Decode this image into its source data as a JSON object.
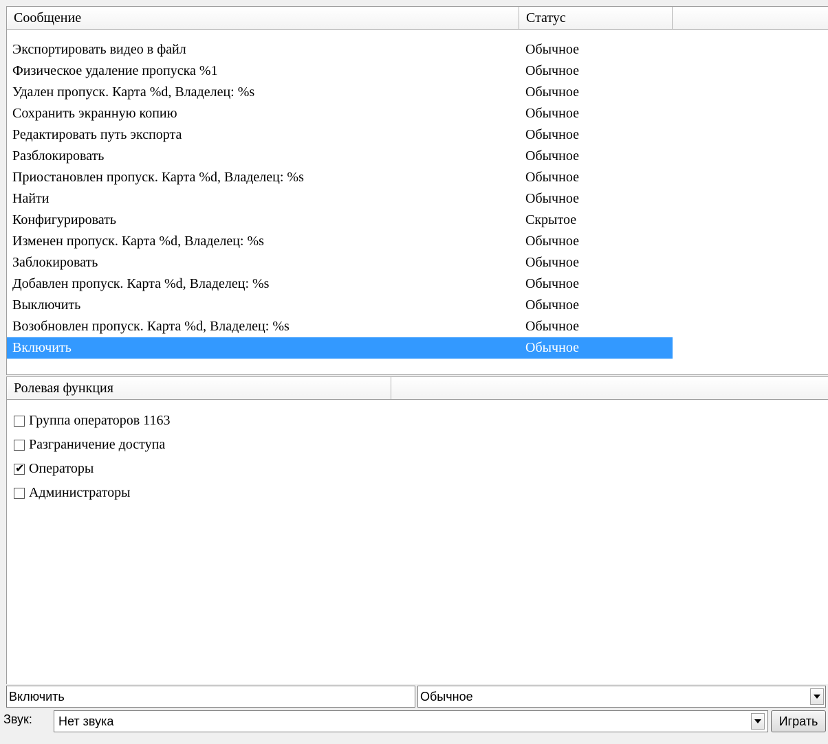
{
  "messages_table": {
    "headers": {
      "message": "Сообщение",
      "status": "Статус"
    },
    "rows": [
      {
        "message": "Экспортировать видео в файл",
        "status": "Обычное"
      },
      {
        "message": "Физическое удаление пропуска %1",
        "status": "Обычное"
      },
      {
        "message": "Удален пропуск. Карта %d, Владелец: %s",
        "status": "Обычное"
      },
      {
        "message": "Сохранить экранную копию",
        "status": "Обычное"
      },
      {
        "message": "Редактировать путь экспорта",
        "status": "Обычное"
      },
      {
        "message": "Разблокировать",
        "status": "Обычное"
      },
      {
        "message": "Приостановлен пропуск. Карта %d, Владелец: %s",
        "status": "Обычное"
      },
      {
        "message": "Найти",
        "status": "Обычное"
      },
      {
        "message": "Конфигурировать",
        "status": "Скрытое"
      },
      {
        "message": "Изменен пропуск. Карта %d, Владелец: %s",
        "status": "Обычное"
      },
      {
        "message": "Заблокировать",
        "status": "Обычное"
      },
      {
        "message": "Добавлен пропуск. Карта %d, Владелец: %s",
        "status": "Обычное"
      },
      {
        "message": "Выключить",
        "status": "Обычное"
      },
      {
        "message": "Возобновлен пропуск. Карта %d, Владелец: %s",
        "status": "Обычное"
      },
      {
        "message": "Включить",
        "status": "Обычное",
        "selected": true
      }
    ],
    "selection_color": "#3399ff"
  },
  "roles": {
    "header": "Ролевая функция",
    "items": [
      {
        "label": "Группа операторов 1163",
        "checked": false
      },
      {
        "label": "Разграничение доступа",
        "checked": false
      },
      {
        "label": "Операторы",
        "checked": true
      },
      {
        "label": "Администраторы",
        "checked": false
      }
    ]
  },
  "editor": {
    "message_value": "Включить",
    "status_value": "Обычное",
    "sound_label": "Звук:",
    "sound_value": "Нет звука",
    "play_button": "Играть"
  }
}
